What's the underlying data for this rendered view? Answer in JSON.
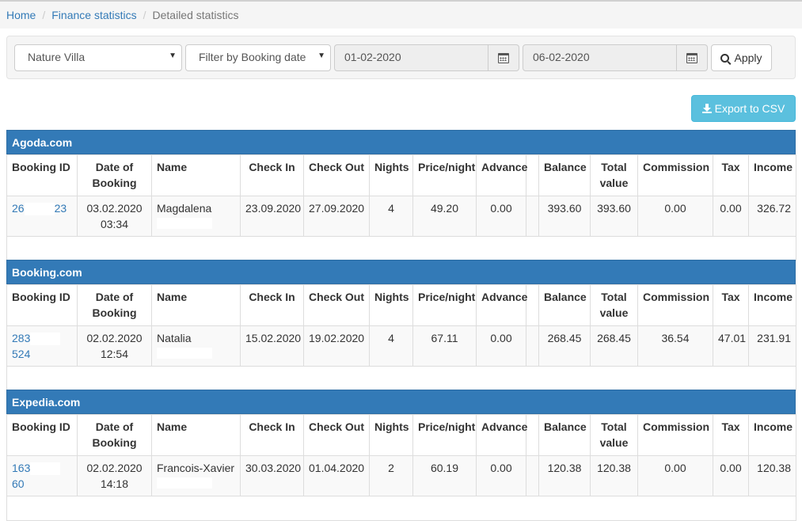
{
  "breadcrumb": {
    "home": "Home",
    "finance": "Finance statistics",
    "current": "Detailed statistics"
  },
  "filters": {
    "property": "Nature Villa",
    "filter_by": "Filter by Booking date",
    "date_from": "01-02-2020",
    "date_to": "06-02-2020",
    "apply_label": "Apply"
  },
  "export_label": "Export to CSV",
  "columns": [
    "Booking ID",
    "Date of Booking",
    "Name",
    "Check In",
    "Check Out",
    "Nights",
    "Price/night",
    "Advance",
    "",
    "Balance",
    "Total value",
    "Commission",
    "Tax",
    "Income"
  ],
  "sections": [
    {
      "title": "Agoda.com",
      "row": {
        "id_start": "26",
        "id_end": "23",
        "date": "03.02.2020",
        "time": "03:34",
        "name": "Magdalena",
        "check_in": "23.09.2020",
        "check_out": "27.09.2020",
        "nights": "4",
        "price": "49.20",
        "advance": "0.00",
        "balance": "393.60",
        "total": "393.60",
        "commission": "0.00",
        "tax": "0.00",
        "income": "326.72"
      }
    },
    {
      "title": "Booking.com",
      "row": {
        "id_start": "283",
        "id_end": "524",
        "date": "02.02.2020",
        "time": "12:54",
        "name": "Natalia",
        "check_in": "15.02.2020",
        "check_out": "19.02.2020",
        "nights": "4",
        "price": "67.11",
        "advance": "0.00",
        "balance": "268.45",
        "total": "268.45",
        "commission": "36.54",
        "tax": "47.01",
        "income": "231.91"
      }
    },
    {
      "title": "Expedia.com",
      "row": {
        "id_start": "163",
        "id_end": "60",
        "date": "02.02.2020",
        "time": "14:18",
        "name": "Francois-Xavier",
        "check_in": "30.03.2020",
        "check_out": "01.04.2020",
        "nights": "2",
        "price": "60.19",
        "advance": "0.00",
        "balance": "120.38",
        "total": "120.38",
        "commission": "0.00",
        "tax": "0.00",
        "income": "120.38"
      }
    }
  ]
}
